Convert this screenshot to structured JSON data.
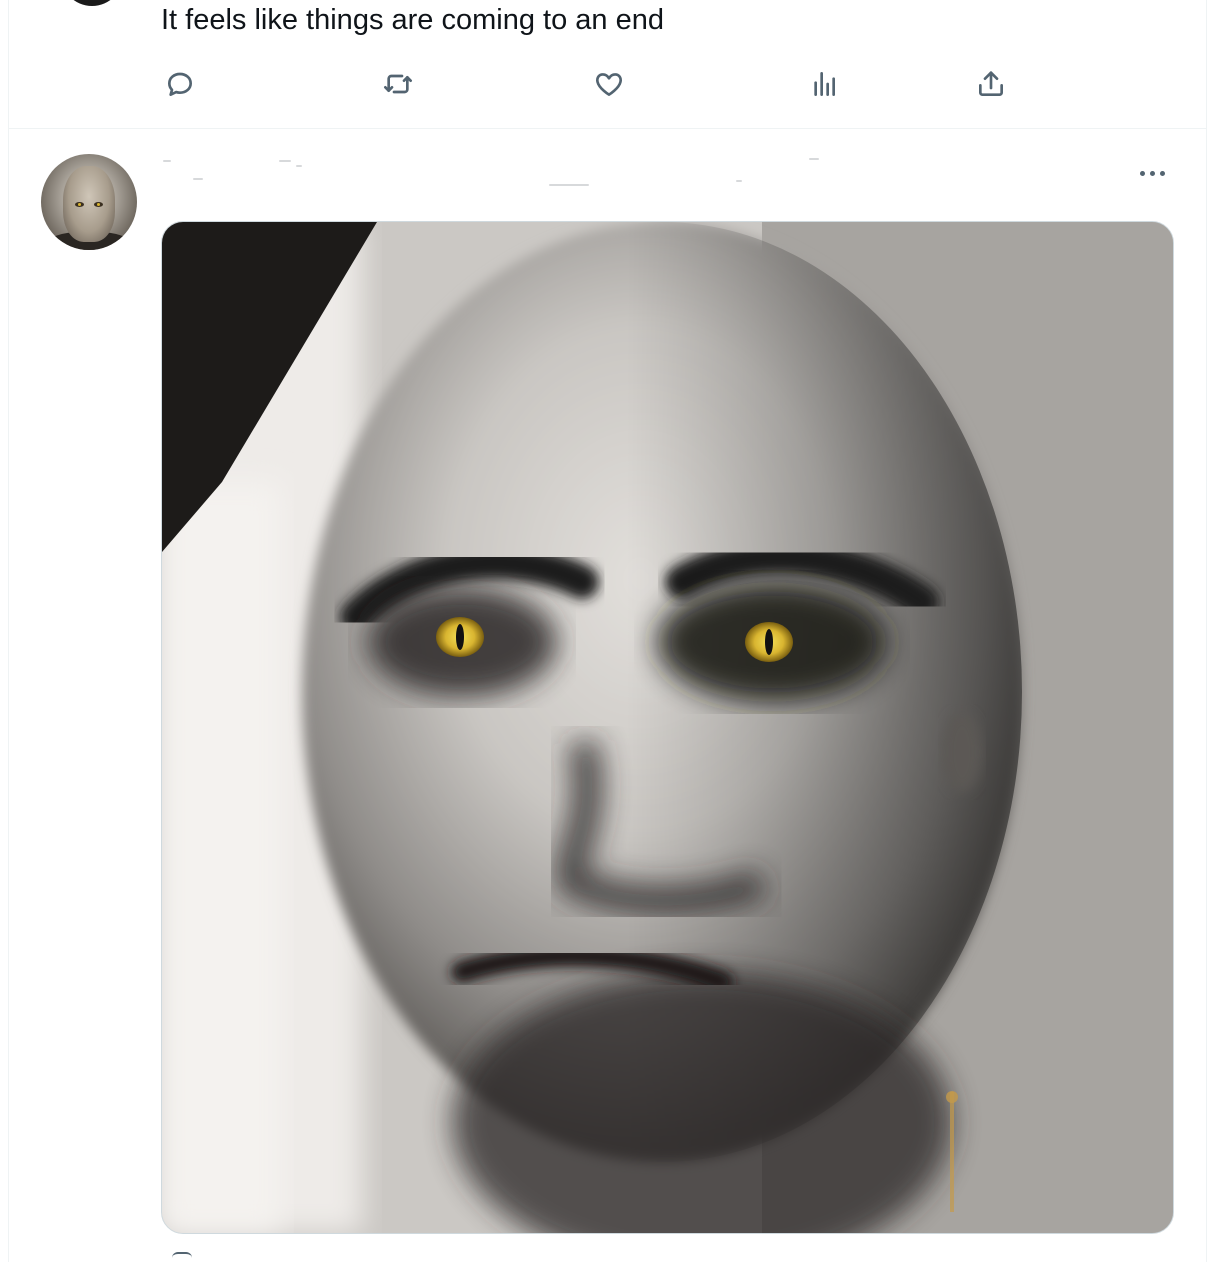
{
  "previous_tweet": {
    "text": "It feels like things are coming to an end",
    "actions": [
      {
        "name": "reply",
        "icon": "reply-icon"
      },
      {
        "name": "retweet",
        "icon": "retweet-icon"
      },
      {
        "name": "like",
        "icon": "heart-icon"
      },
      {
        "name": "views",
        "icon": "analytics-icon"
      },
      {
        "name": "share",
        "icon": "share-icon"
      }
    ]
  },
  "tweet": {
    "avatar": "profile-photo",
    "more_icon": "more-icon",
    "media": "photo of bald man with yellow cat-like eyes"
  },
  "colors": {
    "icon": "#536471",
    "text": "#0f1419",
    "divider": "#eff3f4",
    "eye": "#d9b530"
  }
}
